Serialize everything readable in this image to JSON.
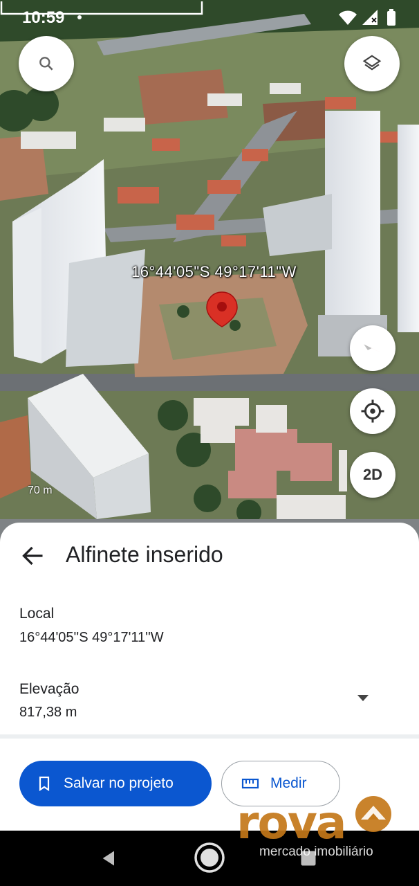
{
  "status_bar": {
    "time": "10:59"
  },
  "map": {
    "coordinate_label": "16°44'05\"S 49°17'11\"W",
    "scale_label": "70 m",
    "buttons": {
      "search_icon": "search-icon",
      "layers_icon": "layers-icon",
      "compass_icon": "compass-icon",
      "location_icon": "my-location-icon",
      "view_mode": "2D"
    },
    "pin_color": "#d93025"
  },
  "sheet": {
    "title": "Alfinete inserido",
    "location_label": "Local",
    "location_value": "16°44'05''S 49°17'11''W",
    "elevation_label": "Elevação",
    "elevation_value": "817,38 m",
    "save_button": "Salvar no projeto",
    "measure_button": "Medir",
    "accent": "#0b57d0"
  },
  "watermark": {
    "brand": "rova",
    "tagline": "mercado imobiliário",
    "color": "#c4781a"
  }
}
